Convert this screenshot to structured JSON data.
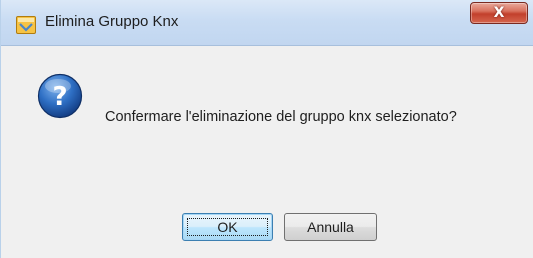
{
  "dialog": {
    "title": "Elimina Gruppo Knx",
    "close_glyph": "X",
    "title_icon": "app-icon",
    "message_icon": "question-icon",
    "message": "Confermare l'eliminazione del gruppo knx selezionato?",
    "buttons": {
      "ok_label": "OK",
      "cancel_label": "Annulla"
    }
  },
  "colors": {
    "titlebar": "#c9dcf3",
    "close_button": "#c2402c",
    "dialog_background": "#f0f0f0",
    "question_icon": "#1f5fb0"
  }
}
